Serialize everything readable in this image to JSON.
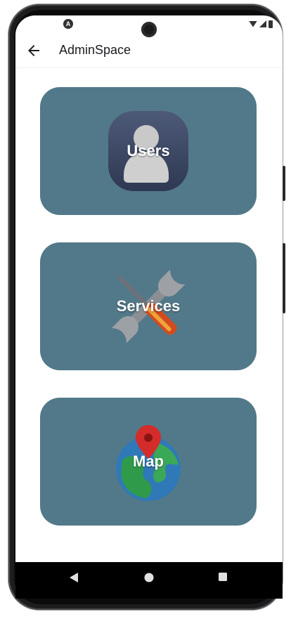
{
  "appbar": {
    "title": "AdminSpace",
    "back_icon": "arrow-back-icon"
  },
  "cards": [
    {
      "label": "Users",
      "icon": "user-icon"
    },
    {
      "label": "Services",
      "icon": "tools-icon"
    },
    {
      "label": "Map",
      "icon": "globe-pin-icon"
    }
  ],
  "status_bar": {
    "left_icon": "android-icon",
    "right_icons": [
      "wifi-icon",
      "signal-icon",
      "battery-icon"
    ]
  },
  "navigation_bar": {
    "buttons": [
      "back-triangle-icon",
      "home-circle-icon",
      "recents-square-icon"
    ]
  },
  "colors": {
    "card_background": "#527989",
    "card_text": "#ffffff",
    "appbar_text": "#1c1b1f"
  }
}
